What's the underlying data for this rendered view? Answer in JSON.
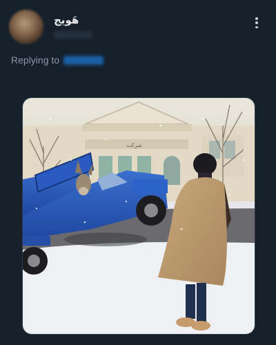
{
  "post": {
    "display_name": "هَويج",
    "reply_prefix": "Replying to"
  },
  "icons": {
    "more": "more-vertical-icon"
  },
  "colors": {
    "background": "#15202b",
    "text_primary": "#e7e9ea",
    "text_secondary": "#8b98a5",
    "mention_link": "#1d9bf0"
  }
}
